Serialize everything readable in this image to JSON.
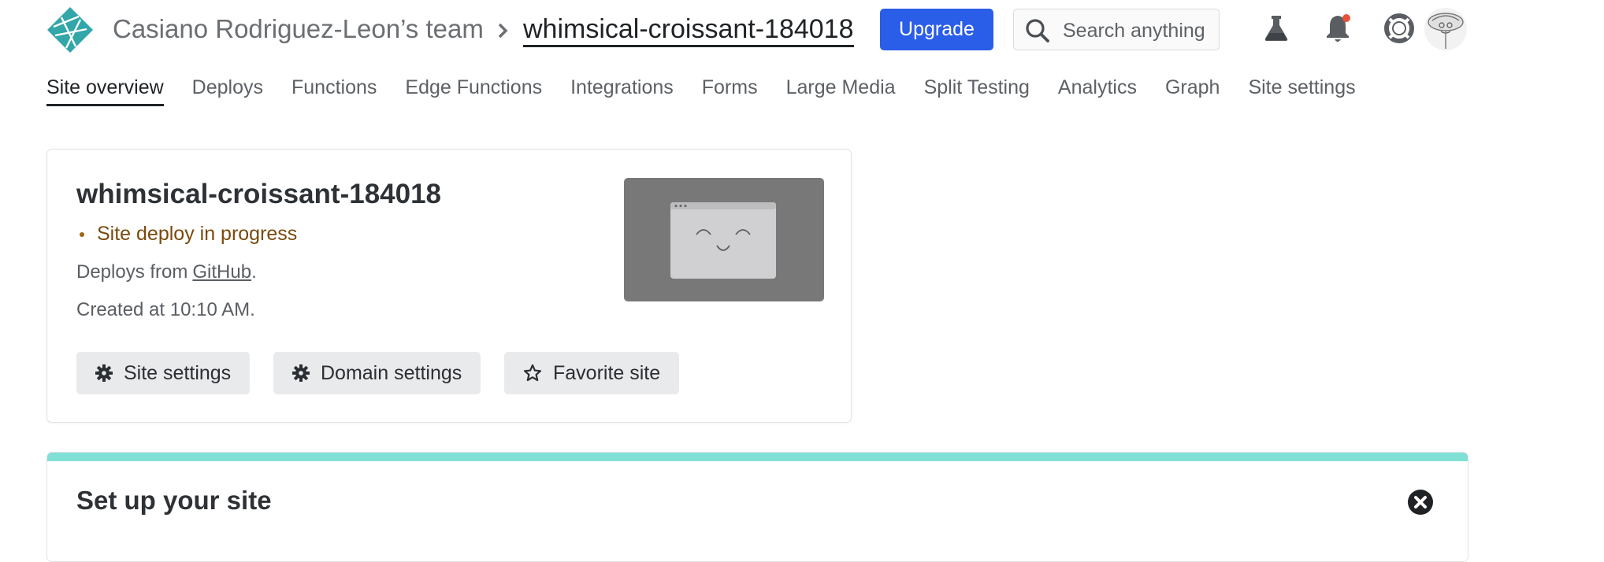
{
  "header": {
    "team_name": "Casiano Rodriguez-Leon’s team",
    "site_name": "whimsical-croissant-184018",
    "upgrade_label": "Upgrade",
    "search_placeholder": "Search anything",
    "brand_color": "#2a5de8",
    "logo_color": "#32a6a8",
    "notification_dot_color": "#e8523a"
  },
  "nav": {
    "items": [
      {
        "label": "Site overview",
        "active": true
      },
      {
        "label": "Deploys"
      },
      {
        "label": "Functions"
      },
      {
        "label": "Edge Functions"
      },
      {
        "label": "Integrations"
      },
      {
        "label": "Forms"
      },
      {
        "label": "Large Media"
      },
      {
        "label": "Split Testing"
      },
      {
        "label": "Analytics"
      },
      {
        "label": "Graph"
      },
      {
        "label": "Site settings"
      }
    ]
  },
  "site_card": {
    "site_name": "whimsical-croissant-184018",
    "status": "Site deploy in progress",
    "status_color": "#a2620f",
    "deploys_from_prefix": "Deploys from",
    "deploys_from_link": "GitHub",
    "deploys_from_suffix": ".",
    "created_at": "Created at 10:10 AM.",
    "buttons": {
      "site_settings": "Site settings",
      "domain_settings": "Domain settings",
      "favorite_site": "Favorite site"
    }
  },
  "setup": {
    "title": "Set up your site",
    "accent_color": "#7fe0d6"
  }
}
